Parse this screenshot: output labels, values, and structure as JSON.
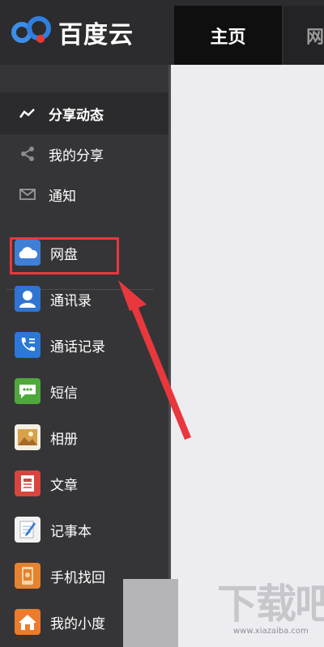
{
  "app": {
    "brand": "百度云"
  },
  "header": {
    "tabs": [
      {
        "label": "主页",
        "active": true
      },
      {
        "label": "网"
      }
    ]
  },
  "sidebar": {
    "top_items": [
      {
        "label": "分享动态",
        "icon": "activity-line-icon",
        "active": true
      },
      {
        "label": "我的分享",
        "icon": "share-icon"
      },
      {
        "label": "通知",
        "icon": "mail-icon"
      }
    ],
    "app_items": [
      {
        "label": "网盘",
        "icon": "cloud-icon",
        "color": "#3f7fd6"
      },
      {
        "label": "通讯录",
        "icon": "contact-icon",
        "color": "#2f74d0"
      },
      {
        "label": "通话记录",
        "icon": "phone-icon",
        "color": "#2b78d6"
      },
      {
        "label": "短信",
        "icon": "message-icon",
        "color": "#4ea83a"
      },
      {
        "label": "相册",
        "icon": "photo-icon",
        "color": "#d8a14a"
      },
      {
        "label": "文章",
        "icon": "article-icon",
        "color": "#d9453e"
      },
      {
        "label": "记事本",
        "icon": "notepad-icon",
        "color": "#f2f2f2"
      },
      {
        "label": "手机找回",
        "icon": "phone-find-icon",
        "color": "#e5832e"
      },
      {
        "label": "我的小度",
        "icon": "home-icon",
        "color": "#ec7b2c"
      }
    ]
  },
  "annotation": {
    "color": "#e8383d"
  },
  "watermark": {
    "text": "下载吧",
    "domain": "www.xiazaiba.com"
  }
}
